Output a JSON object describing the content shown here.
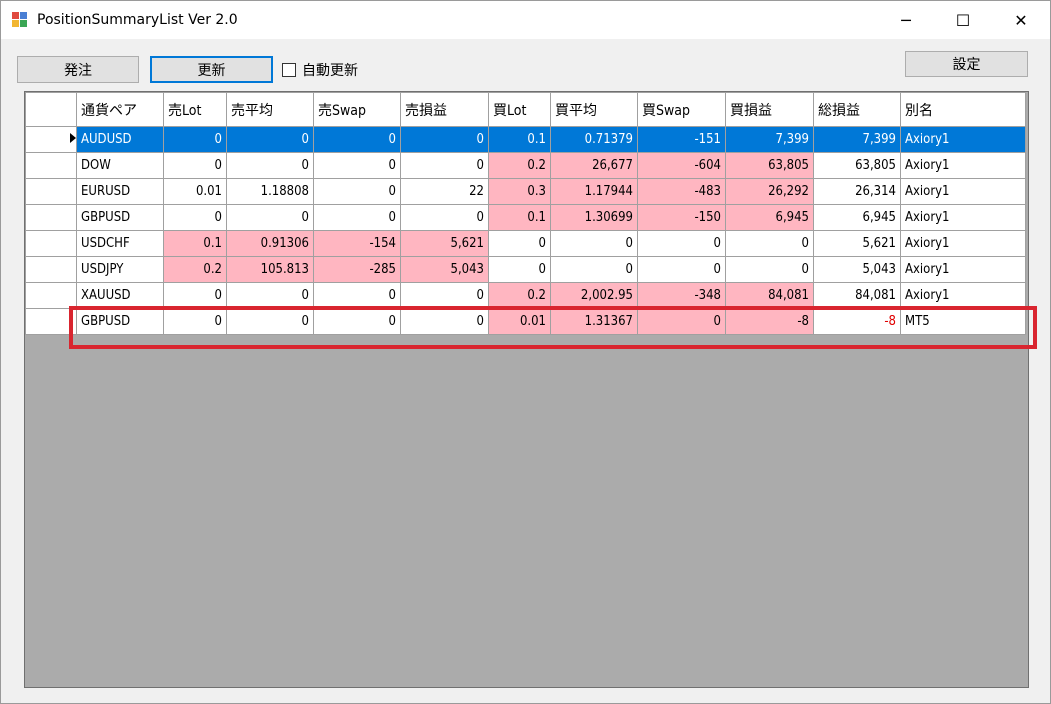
{
  "window": {
    "title": "PositionSummaryList Ver 2.0",
    "minimize_glyph": "─",
    "maximize_glyph": "☐",
    "close_glyph": "✕"
  },
  "toolbar": {
    "order_label": "発注",
    "refresh_label": "更新",
    "auto_refresh_label": "自動更新",
    "auto_refresh_checked": false,
    "settings_label": "設定"
  },
  "grid": {
    "columns": [
      "通貨ペア",
      "売Lot",
      "売平均",
      "売Swap",
      "売損益",
      "買Lot",
      "買平均",
      "買Swap",
      "買損益",
      "総損益",
      "別名"
    ],
    "rows": [
      {
        "cells": [
          "AUDUSD",
          "0",
          "0",
          "0",
          "0",
          "0.1",
          "0.71379",
          "-151",
          "7,399",
          "7,399",
          "Axiory1"
        ],
        "pink": [],
        "selected": true
      },
      {
        "cells": [
          "DOW",
          "0",
          "0",
          "0",
          "0",
          "0.2",
          "26,677",
          "-604",
          "63,805",
          "63,805",
          "Axiory1"
        ],
        "pink": [
          5,
          6,
          7,
          8
        ],
        "selected": false
      },
      {
        "cells": [
          "EURUSD",
          "0.01",
          "1.18808",
          "0",
          "22",
          "0.3",
          "1.17944",
          "-483",
          "26,292",
          "26,314",
          "Axiory1"
        ],
        "pink": [
          5,
          6,
          7,
          8
        ],
        "selected": false
      },
      {
        "cells": [
          "GBPUSD",
          "0",
          "0",
          "0",
          "0",
          "0.1",
          "1.30699",
          "-150",
          "6,945",
          "6,945",
          "Axiory1"
        ],
        "pink": [
          5,
          6,
          7,
          8
        ],
        "selected": false
      },
      {
        "cells": [
          "USDCHF",
          "0.1",
          "0.91306",
          "-154",
          "5,621",
          "0",
          "0",
          "0",
          "0",
          "5,621",
          "Axiory1"
        ],
        "pink": [
          1,
          2,
          3,
          4
        ],
        "selected": false
      },
      {
        "cells": [
          "USDJPY",
          "0.2",
          "105.813",
          "-285",
          "5,043",
          "0",
          "0",
          "0",
          "0",
          "5,043",
          "Axiory1"
        ],
        "pink": [
          1,
          2,
          3,
          4
        ],
        "selected": false
      },
      {
        "cells": [
          "XAUUSD",
          "0",
          "0",
          "0",
          "0",
          "0.2",
          "2,002.95",
          "-348",
          "84,081",
          "84,081",
          "Axiory1"
        ],
        "pink": [
          5,
          6,
          7,
          8
        ],
        "selected": false
      },
      {
        "cells": [
          "GBPUSD",
          "0",
          "0",
          "0",
          "0",
          "0.01",
          "1.31367",
          "0",
          "-8",
          "-8",
          "MT5"
        ],
        "pink": [
          5,
          6,
          7,
          8
        ],
        "selected": false,
        "negative_total": true
      }
    ]
  },
  "colors": {
    "selection": "#0078d7",
    "pink_cell": "#ffb6c1",
    "highlight_border": "#d9252f",
    "negative_text": "#e00000",
    "grid_background": "#ababab"
  }
}
